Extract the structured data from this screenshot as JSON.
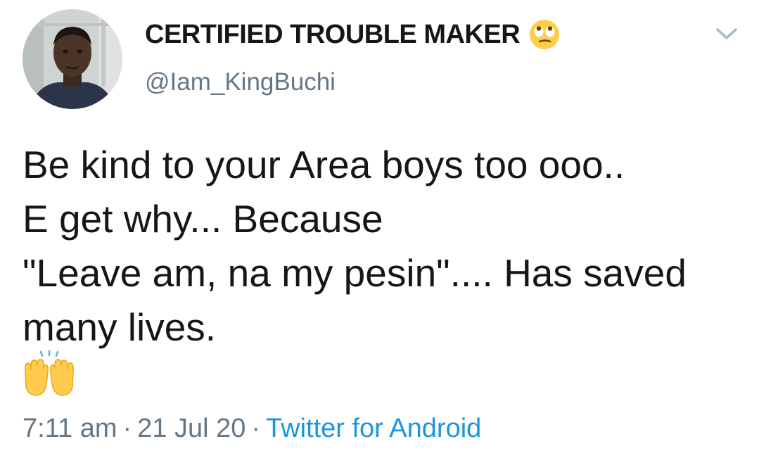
{
  "tweet": {
    "author": {
      "display_name": "CERTIFIED TROUBLE MAKER",
      "display_name_emoji": "face-with-rolling-eyes-icon",
      "handle": "@Iam_KingBuchi"
    },
    "text_lines": [
      "Be kind to your Area boys too ooo..",
      "E get why... Because",
      "\"Leave am, na my pesin\".... Has saved",
      "many lives."
    ],
    "trailing_emoji": "raising-hands-icon",
    "time": "7:11 am",
    "date": "21 Jul 20",
    "separator": "·",
    "source": "Twitter for Android"
  },
  "colors": {
    "text": "#14171a",
    "secondary": "#657786",
    "link": "#1b95e0",
    "emoji_yellow": "#ffcc4d"
  }
}
